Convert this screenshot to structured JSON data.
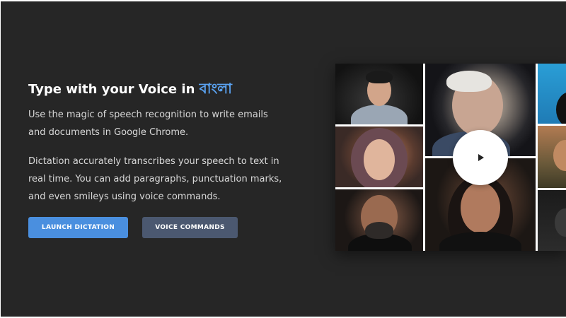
{
  "hero": {
    "title_prefix": "Type with your Voice in ",
    "title_language": "বাংলা",
    "paragraph1": "Use the magic of speech recognition to write emails and documents in Google Chrome.",
    "paragraph2": "Dictation accurately transcribes your speech to text in real time. You can add paragraphs, punctuation marks, and even smileys using voice commands.",
    "launch_button": "LAUNCH DICTATION",
    "commands_button": "VOICE COMMANDS"
  },
  "colors": {
    "background": "#262626",
    "accent_language": "#5aa2f0",
    "primary_button": "#4a8fdf",
    "secondary_button": "#4b5870"
  },
  "video": {
    "play_icon": "play-icon"
  }
}
